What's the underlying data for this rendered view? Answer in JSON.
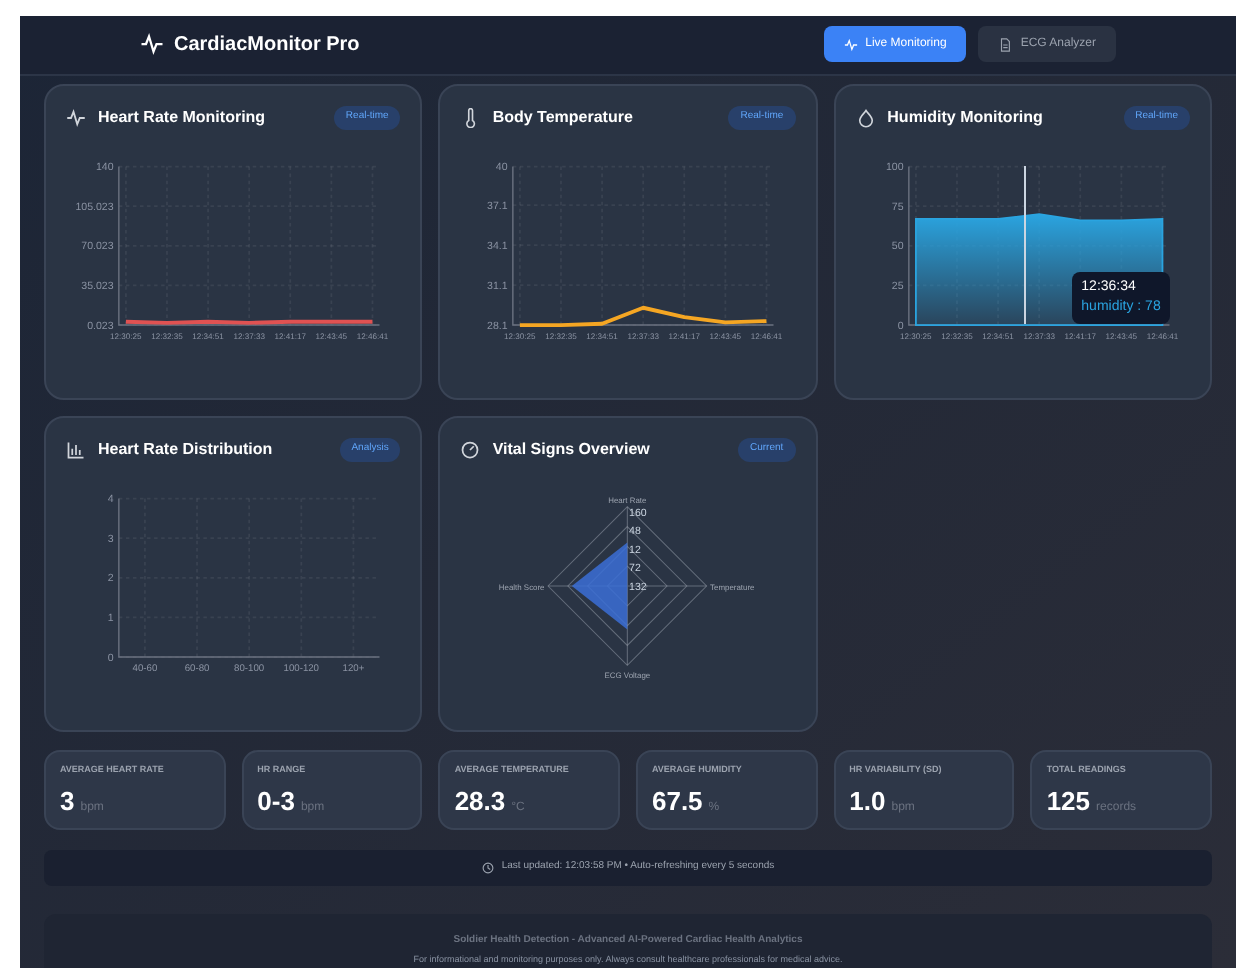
{
  "header": {
    "title": "CardiacMonitor Pro",
    "tabs": [
      {
        "label": "Live Monitoring",
        "selected": true
      },
      {
        "label": "ECG Analyzer",
        "selected": false
      }
    ]
  },
  "cards": [
    {
      "kind": "line",
      "title": "Heart Rate Monitoring",
      "badge": "Real-time",
      "chart_data": {
        "type": "line",
        "grid": true,
        "categories": [
          "12:30:25",
          "12:32:35",
          "12:34:51",
          "12:37:33",
          "12:41:17",
          "12:43:45",
          "12:46:41"
        ],
        "ylim": [
          0.023,
          140
        ],
        "yticks": [
          0.023,
          {
            "value": 35.023,
            "label": "35.023"
          },
          {
            "value": 70.023,
            "label": "70.023"
          },
          {
            "value": 105.023,
            "label": "105.023"
          },
          140
        ],
        "series": [
          {
            "color": "#e05252",
            "values": [
              3,
              2,
              3,
              2,
              3,
              3,
              3
            ]
          }
        ]
      }
    },
    {
      "kind": "line",
      "title": "Body Temperature",
      "badge": "Real-time",
      "chart_data": {
        "type": "line",
        "grid": true,
        "categories": [
          "12:30:25",
          "12:32:35",
          "12:34:51",
          "12:37:33",
          "12:41:17",
          "12:43:45",
          "12:46:41"
        ],
        "ylim": [
          28.1,
          40
        ],
        "yticks": [
          28.1,
          31.1,
          34.1,
          37.1,
          40
        ],
        "series": [
          {
            "color": "#f5a623",
            "values": [
              28.1,
              28.1,
              28.2,
              29.4,
              28.7,
              28.3,
              28.4
            ]
          }
        ]
      }
    },
    {
      "kind": "area",
      "title": "Humidity Monitoring",
      "badge": "Real-time",
      "tooltip": {
        "time": "12:36:34",
        "text": "humidity : 78"
      },
      "chart_data": {
        "type": "area",
        "grid": true,
        "categories": [
          "12:30:25",
          "12:32:35",
          "12:34:51",
          "12:37:33",
          "12:41:17",
          "12:43:45",
          "12:46:41"
        ],
        "ylim": [
          0,
          100
        ],
        "yticks": [
          0,
          25,
          50,
          75,
          100
        ],
        "series": [
          {
            "color": "#2aa4e0",
            "values": [
              67,
              67,
              67,
              70,
              66,
              66,
              67
            ]
          }
        ]
      }
    },
    {
      "kind": "bar",
      "title": "Heart Rate Distribution",
      "badge": "Analysis",
      "chart_data": {
        "type": "bar",
        "grid": true,
        "categories": [
          "40-60",
          "60-80",
          "80-100",
          "100-120",
          "120+"
        ],
        "ylim": [
          0,
          4
        ],
        "yticks": [
          0,
          1,
          2,
          3,
          4
        ],
        "series": [
          {
            "color": "#3b82f6",
            "values": [
              0,
              0,
              0,
              0,
              0
            ]
          }
        ]
      }
    },
    {
      "kind": "radar",
      "title": "Vital Signs Overview",
      "badge": "Current",
      "axes": [
        "Heart Rate",
        "Temperature",
        "ECG Voltage",
        "Health Score"
      ],
      "ticks": [
        "160",
        "48",
        "12",
        "72",
        "132"
      ]
    }
  ],
  "stats": [
    {
      "label": "AVERAGE HEART RATE",
      "value": "3",
      "unit": "bpm"
    },
    {
      "label": "HR RANGE",
      "value": "0-3",
      "unit": "bpm"
    },
    {
      "label": "AVERAGE TEMPERATURE",
      "value": "28.3",
      "unit": "°C"
    },
    {
      "label": "AVERAGE HUMIDITY",
      "value": "67.5",
      "unit": "%"
    },
    {
      "label": "HR VARIABILITY (SD)",
      "value": "1.0",
      "unit": "bpm"
    },
    {
      "label": "TOTAL READINGS",
      "value": "125",
      "unit": "records"
    }
  ],
  "status": "Last updated: 12:03:58 PM • Auto-refreshing every 5 seconds",
  "footer": {
    "title": "Soldier Health Detection - Advanced AI-Powered Cardiac Health Analytics",
    "note": "For informational and monitoring purposes only. Always consult healthcare professionals for medical advice."
  }
}
